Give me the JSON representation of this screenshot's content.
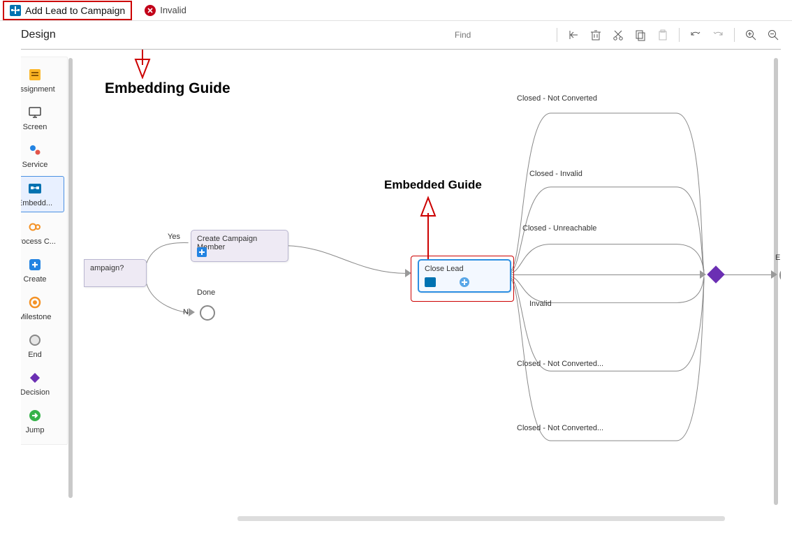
{
  "topbar": {
    "tab_title": "Add Lead to Campaign",
    "invalid_label": "Invalid"
  },
  "design_row": {
    "label": "Design",
    "find_placeholder": "Find"
  },
  "palette": [
    {
      "key": "assignment",
      "label": "Assignment"
    },
    {
      "key": "screen",
      "label": "Screen"
    },
    {
      "key": "service",
      "label": "Service"
    },
    {
      "key": "embedded",
      "label": "Embedd..."
    },
    {
      "key": "processc",
      "label": "Process C..."
    },
    {
      "key": "create",
      "label": "Create"
    },
    {
      "key": "milestone",
      "label": "Milestone"
    },
    {
      "key": "end",
      "label": "End"
    },
    {
      "key": "decision",
      "label": "Decision"
    },
    {
      "key": "jump",
      "label": "Jump"
    }
  ],
  "annotations": {
    "embedding_guide": "Embedding Guide",
    "embedded_guide": "Embedded Guide"
  },
  "nodes": {
    "campaign_node_label": "ampaign?",
    "create_member_label": "Create Campaign Member",
    "close_lead_label": "Close Lead",
    "end_label": "End"
  },
  "edge_labels": {
    "yes": "Yes",
    "no": "No",
    "done": "Done",
    "invalid": "Invalid",
    "closed_invalid": "Closed - Invalid",
    "closed_unreachable": "Closed - Unreachable",
    "closed_not_converted_top": "Closed - Not Converted",
    "closed_not_converted_mid": "Closed - Not Converted...",
    "closed_not_converted_bot": "Closed - Not Converted..."
  }
}
